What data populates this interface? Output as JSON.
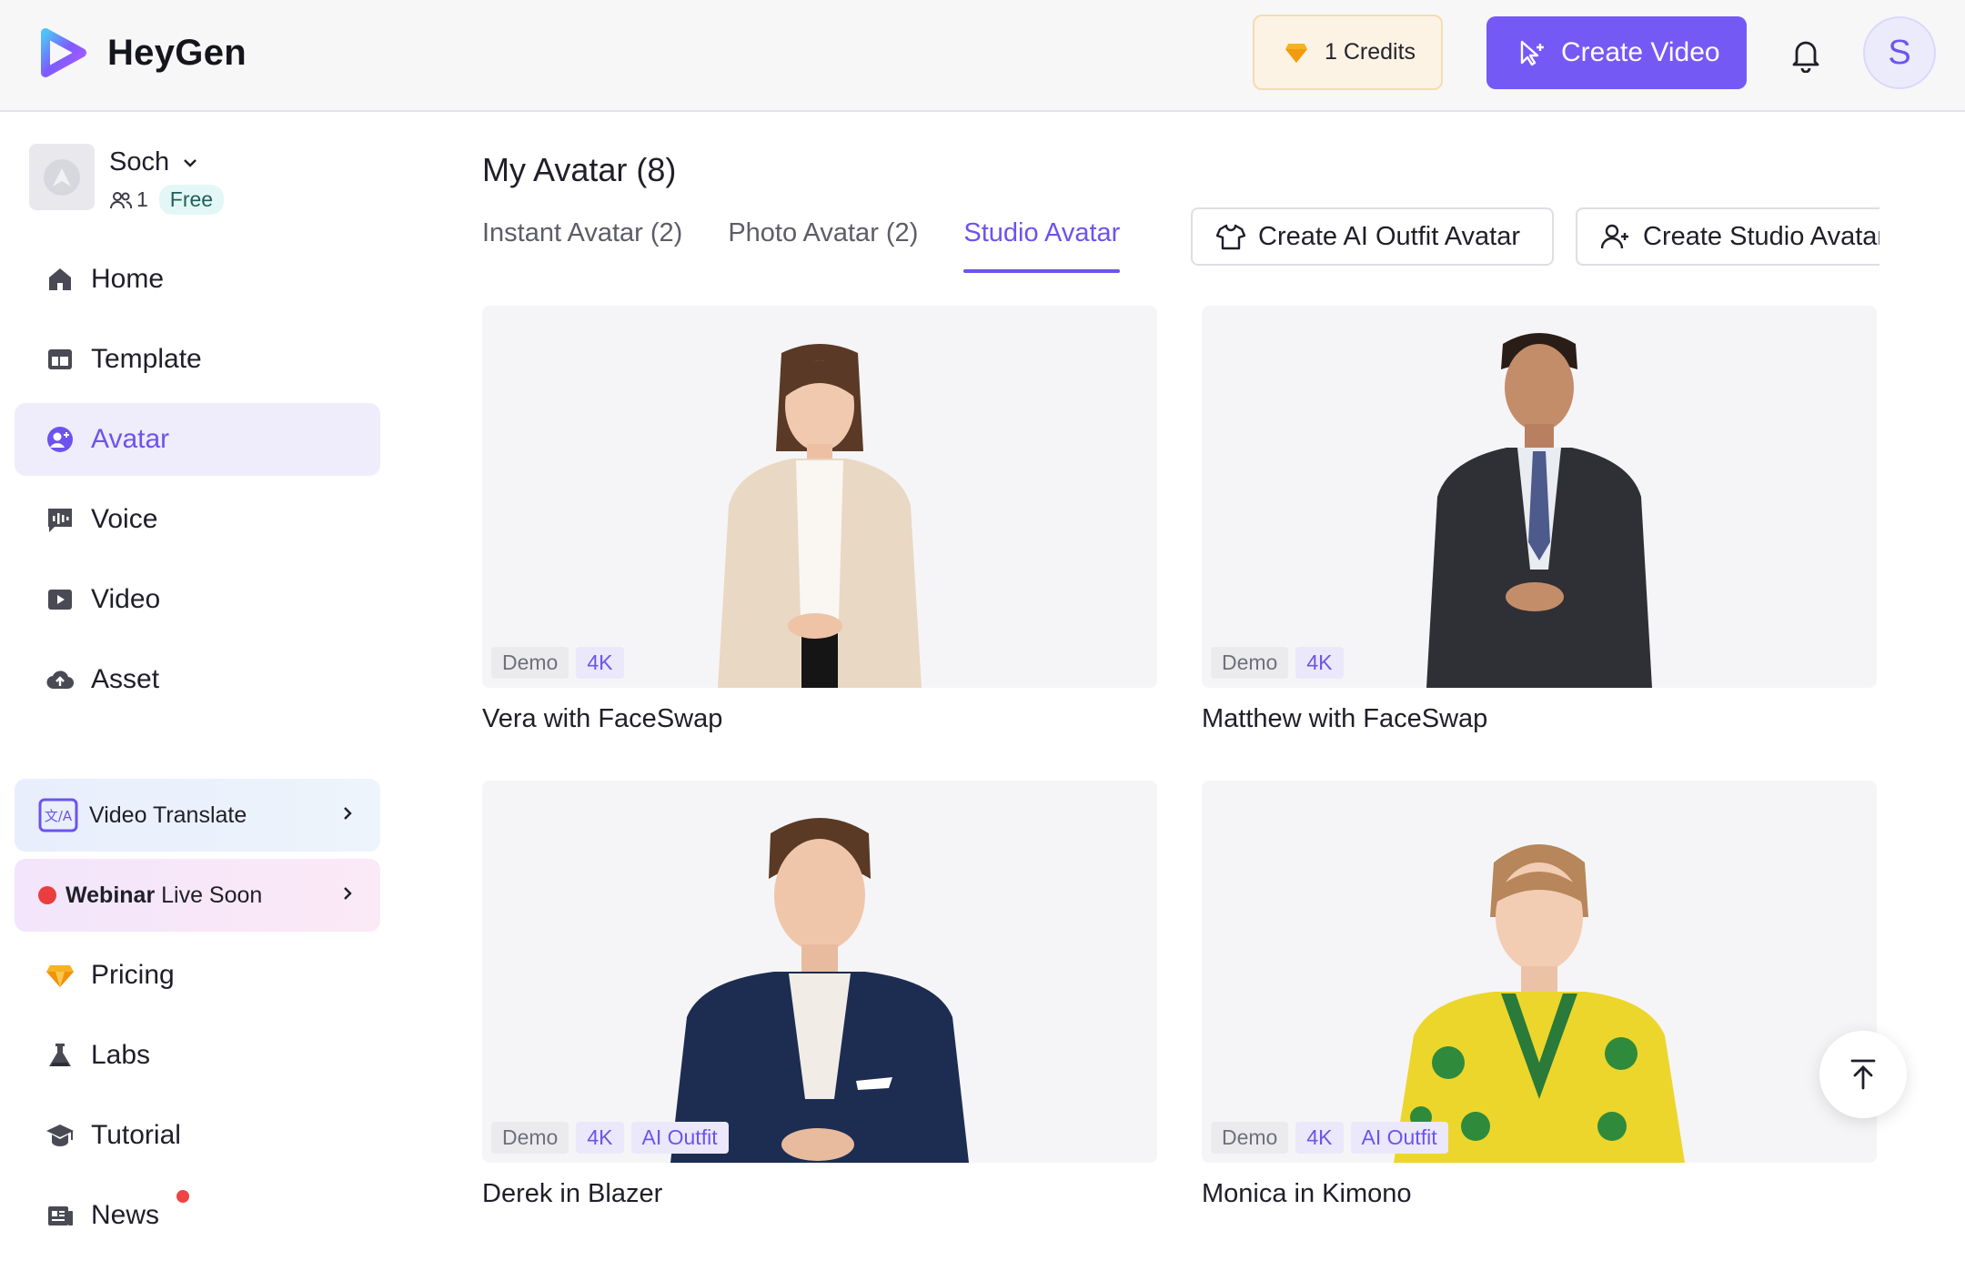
{
  "app": {
    "name": "HeyGen"
  },
  "header": {
    "credits_label": "1 Credits",
    "create_video_label": "Create Video",
    "user_initial": "S"
  },
  "workspace": {
    "name": "Soch",
    "member_count": "1",
    "plan": "Free"
  },
  "sidebar": {
    "items": [
      {
        "label": "Home",
        "icon": "home-icon"
      },
      {
        "label": "Template",
        "icon": "template-icon"
      },
      {
        "label": "Avatar",
        "icon": "avatar-icon",
        "active": true
      },
      {
        "label": "Voice",
        "icon": "voice-icon"
      },
      {
        "label": "Video",
        "icon": "video-icon"
      },
      {
        "label": "Asset",
        "icon": "cloud-upload-icon"
      }
    ],
    "promos": {
      "translate": "Video Translate",
      "webinar_bold": "Webinar",
      "webinar_rest": " Live Soon"
    },
    "bottom_items": [
      {
        "label": "Pricing",
        "icon": "diamond-icon"
      },
      {
        "label": "Labs",
        "icon": "flask-icon"
      },
      {
        "label": "Tutorial",
        "icon": "graduation-cap-icon"
      },
      {
        "label": "News",
        "icon": "newspaper-icon",
        "has_dot": true
      }
    ]
  },
  "main": {
    "title": "My Avatar (8)",
    "tabs": [
      {
        "label": "Instant Avatar (2)"
      },
      {
        "label": "Photo Avatar (2)"
      },
      {
        "label": "Studio Avatar",
        "active": true
      }
    ],
    "actions": {
      "outfit": "Create AI Outfit Avatar",
      "studio": "Create Studio Avatar"
    },
    "cards": [
      {
        "name": "Vera with FaceSwap",
        "tags": [
          "Demo",
          "4K"
        ]
      },
      {
        "name": "Matthew with FaceSwap",
        "tags": [
          "Demo",
          "4K"
        ]
      },
      {
        "name": "Derek in Blazer",
        "tags": [
          "Demo",
          "4K",
          "AI Outfit"
        ]
      },
      {
        "name": "Monica in Kimono",
        "tags": [
          "Demo",
          "4K",
          "AI Outfit"
        ]
      }
    ]
  },
  "colors": {
    "accent": "#7559f5",
    "active_text": "#6d53ee",
    "credits_bg": "#fdf3e4"
  }
}
